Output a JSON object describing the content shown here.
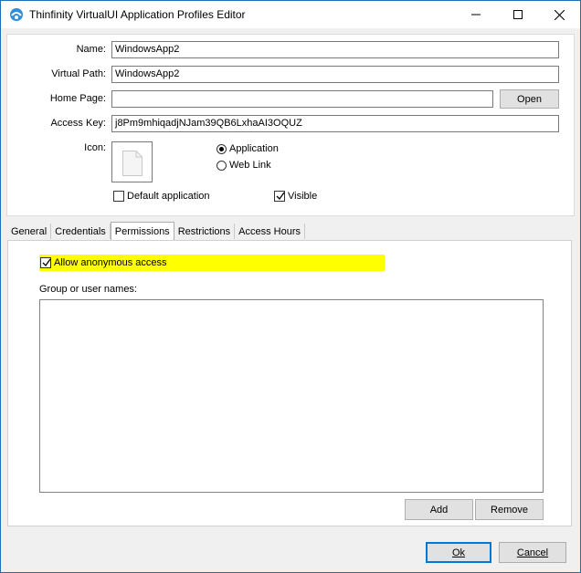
{
  "window": {
    "title": "Thinfinity VirtualUI Application Profiles Editor",
    "app_icon": "thinfinity-app-icon",
    "controls": [
      "minimize-icon",
      "maximize-icon",
      "close-icon"
    ]
  },
  "form": {
    "name_label": "Name:",
    "name_value": "WindowsApp2",
    "virtual_path_label": "Virtual Path:",
    "virtual_path_value": "WindowsApp2",
    "home_page_label": "Home Page:",
    "home_page_value": "",
    "open_button": "Open",
    "access_key_label": "Access Key:",
    "access_key_value": "j8Pm9mhiqadjNJam39QB6LxhaAI3OQUZ",
    "icon_label": "Icon:",
    "icon_preview": "document-icon",
    "type_options": [
      {
        "label": "Application",
        "selected": true
      },
      {
        "label": "Web Link",
        "selected": false
      }
    ],
    "default_application_label": "Default application",
    "default_application_checked": false,
    "visible_label": "Visible",
    "visible_checked": true
  },
  "tabs": [
    {
      "label": "General",
      "active": false
    },
    {
      "label": "Credentials",
      "active": false
    },
    {
      "label": "Permissions",
      "active": true
    },
    {
      "label": "Restrictions",
      "active": false
    },
    {
      "label": "Access Hours",
      "active": false
    }
  ],
  "permissions": {
    "allow_anonymous_label": "Allow anonymous access",
    "allow_anonymous_checked": true,
    "group_label": "Group or user names:",
    "group_items": [],
    "add_button": "Add",
    "remove_button": "Remove"
  },
  "footer": {
    "ok_button": "Ok",
    "cancel_button": "Cancel"
  },
  "colors": {
    "highlight": "#ffff00",
    "focus_border": "#0078d7"
  }
}
